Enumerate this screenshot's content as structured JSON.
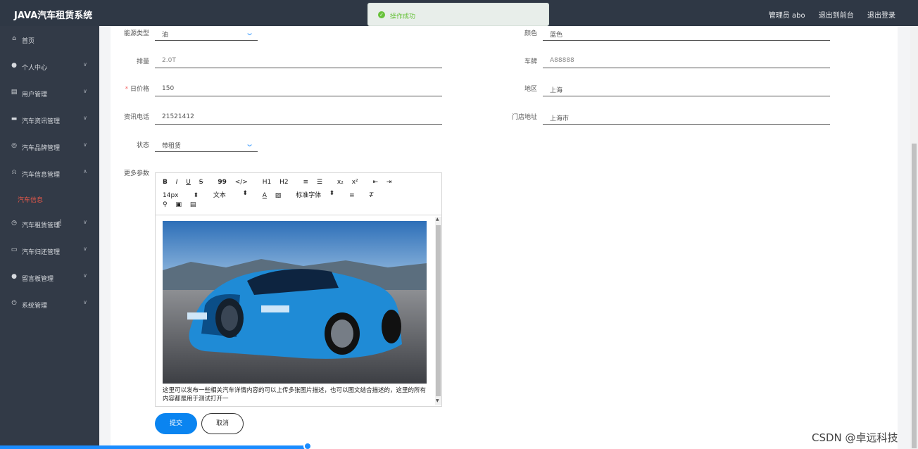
{
  "app": {
    "title": "JAVA汽车租赁系统"
  },
  "header": {
    "user": "管理员 abo",
    "to_front": "退出到前台",
    "logout": "退出登录"
  },
  "toast": {
    "message": "操作成功",
    "icon": "check-icon"
  },
  "sidebar": {
    "items": [
      {
        "label": "首页",
        "icon": "home-icon"
      },
      {
        "label": "个人中心",
        "icon": "user-icon"
      },
      {
        "label": "用户管理",
        "icon": "briefcase-icon"
      },
      {
        "label": "汽车资讯管理",
        "icon": "chat-icon"
      },
      {
        "label": "汽车品牌管理",
        "icon": "compass-icon"
      },
      {
        "label": "汽车信息管理",
        "icon": "alarm-icon"
      },
      {
        "label": "汽车租赁管理",
        "icon": "clock-icon"
      },
      {
        "label": "汽车归还管理",
        "icon": "card-icon"
      },
      {
        "label": "留言板管理",
        "icon": "user-icon"
      },
      {
        "label": "系统管理",
        "icon": "power-icon"
      }
    ],
    "active_sub": "汽车信息"
  },
  "form": {
    "energy_label": "能源类型",
    "energy_value": "油",
    "color_label": "颜色",
    "color_value": "蓝色",
    "displacement_label": "排量",
    "displacement_value": "2.0T",
    "plate_label": "车牌",
    "plate_value": "A88888",
    "price_label": "日价格",
    "price_value": "150",
    "region_label": "地区",
    "region_value": "上海",
    "phone_label": "资讯电话",
    "phone_value": "21521412",
    "address_label": "门店地址",
    "address_value": "上海市",
    "status_label": "状态",
    "status_value": "带租赁",
    "more_label": "更多参数"
  },
  "editor": {
    "toolbar_row1": [
      "B",
      "I",
      "U",
      "S",
      "99",
      "</>",
      "H1",
      "H2",
      "≡",
      "☰",
      "x₂",
      "x²",
      "⇤",
      "⇥"
    ],
    "font_size": "14px",
    "text_style": "文本",
    "font_family": "标准字体",
    "content_text": "这里可以发布一些相关汽车详情内容的可以上传多张图片描述，也可以图文结合描述的，这里的所有内容都是用于测试打开一"
  },
  "actions": {
    "submit": "提交",
    "cancel": "取消"
  },
  "watermark": "CSDN @卓远科技",
  "colors": {
    "primary": "#0a84f0",
    "sidebar_bg": "#323a47",
    "active": "#e6584a",
    "success": "#67c23a"
  }
}
